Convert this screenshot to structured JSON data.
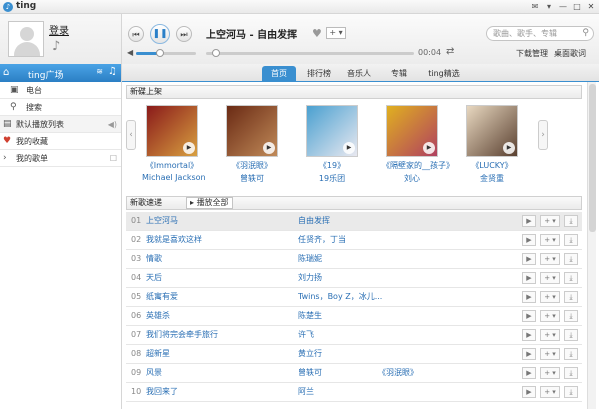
{
  "window": {
    "title": "ting",
    "controls": [
      "✉",
      "▾",
      "—",
      "□",
      "✕"
    ]
  },
  "user": {
    "login_label": "登录"
  },
  "player": {
    "song_title": "上空河马 - 自由发挥",
    "time": "00:04",
    "search_placeholder": "歌曲、歌手、专辑",
    "download_manager": "下载管理",
    "desktop_lyrics": "桌面歌词",
    "volume_percent": 40
  },
  "sidebar": {
    "header_label": "ting广场",
    "items": [
      {
        "label": "电台",
        "icon": "radio-icon"
      },
      {
        "label": "搜索",
        "icon": "search-icon"
      }
    ],
    "sections": [
      {
        "label": "默认播放列表",
        "icon": "playlist-icon",
        "suffix": "◀)"
      },
      {
        "label": "我的收藏",
        "icon": "heart-icon",
        "suffix": ""
      },
      {
        "label": "我的歌单",
        "icon": "expand-icon",
        "suffix": "☐"
      }
    ]
  },
  "tabs": [
    "首页",
    "排行榜",
    "音乐人",
    "专辑",
    "ting精选"
  ],
  "new_releases": {
    "heading": "新碟上架",
    "albums": [
      {
        "title": "《Immortal》",
        "artist": "Michael Jackson",
        "color1": "#8a1a1a",
        "color2": "#d8a040"
      },
      {
        "title": "《羽泯眼》",
        "artist": "曾轶可",
        "color1": "#6a2a14",
        "color2": "#c08a58"
      },
      {
        "title": "《19》",
        "artist": "19乐团",
        "color1": "#4aa0d0",
        "color2": "#e8e8f0"
      },
      {
        "title": "《隔壁家的__孩子》",
        "artist": "刘心",
        "color1": "#e0b020",
        "color2": "#b04060"
      },
      {
        "title": "《LUCKY》",
        "artist": "金贤重",
        "color1": "#e8d8c0",
        "color2": "#5a4030"
      }
    ]
  },
  "new_songs": {
    "heading": "新歌速递",
    "play_all": "播放全部",
    "rows": [
      {
        "num": "01",
        "name": "上空河马",
        "artist": "自由发挥",
        "album": ""
      },
      {
        "num": "02",
        "name": "我就是喜欢这样",
        "artist": "任贤齐，丁当",
        "album": ""
      },
      {
        "num": "03",
        "name": "情歌",
        "artist": "陈瑞妮",
        "album": ""
      },
      {
        "num": "04",
        "name": "天后",
        "artist": "刘力扬",
        "album": ""
      },
      {
        "num": "05",
        "name": "纸寓有爱",
        "artist": "Twins，Boy Z，冰儿...",
        "album": ""
      },
      {
        "num": "06",
        "name": "英雄杀",
        "artist": "陈楚生",
        "album": ""
      },
      {
        "num": "07",
        "name": "我们将完会牵手旅行",
        "artist": "许飞",
        "album": ""
      },
      {
        "num": "08",
        "name": "超新星",
        "artist": "黄立行",
        "album": ""
      },
      {
        "num": "09",
        "name": "风景",
        "artist": "曾轶可",
        "album": "《羽泯眼》"
      },
      {
        "num": "10",
        "name": "我回来了",
        "artist": "阿兰",
        "album": ""
      }
    ]
  }
}
